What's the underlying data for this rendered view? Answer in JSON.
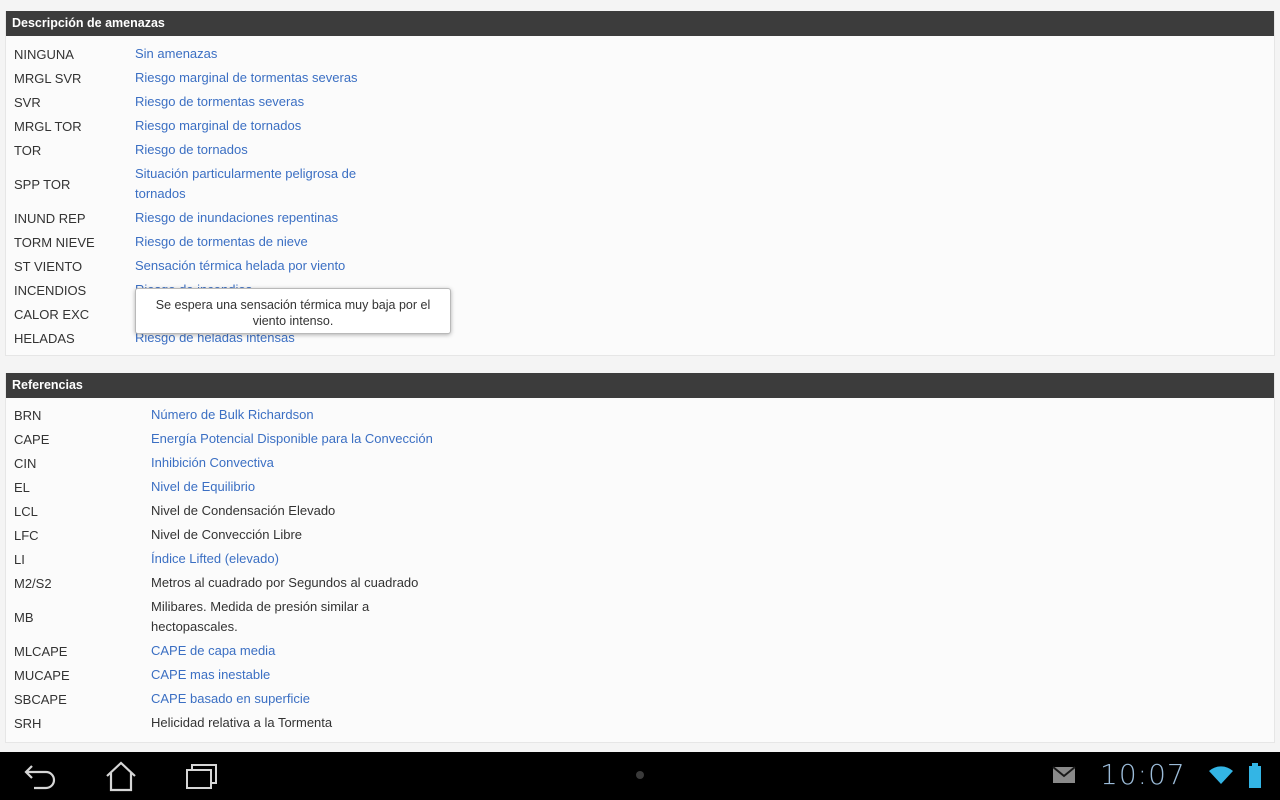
{
  "threats": {
    "title": "Descripción de amenazas",
    "items": [
      {
        "code": "NINGUNA",
        "desc": "Sin amenazas",
        "link": true
      },
      {
        "code": "MRGL SVR",
        "desc": "Riesgo marginal de tormentas severas",
        "link": true
      },
      {
        "code": "SVR",
        "desc": "Riesgo de tormentas severas",
        "link": true
      },
      {
        "code": "MRGL TOR",
        "desc": "Riesgo marginal de tornados",
        "link": true
      },
      {
        "code": "TOR",
        "desc": "Riesgo de tornados",
        "link": true
      },
      {
        "code": "SPP TOR",
        "desc": "Situación particularmente peligrosa de tornados",
        "link": true
      },
      {
        "code": "INUND REP",
        "desc": "Riesgo de inundaciones repentinas",
        "link": true
      },
      {
        "code": "TORM NIEVE",
        "desc": "Riesgo de tormentas de nieve",
        "link": true
      },
      {
        "code": "ST VIENTO",
        "desc": "Sensación térmica helada por viento",
        "link": true
      },
      {
        "code": "INCENDIOS",
        "desc": "Riesgo de incendios",
        "link": true
      },
      {
        "code": "CALOR EXC",
        "desc": "",
        "link": true
      },
      {
        "code": "HELADAS",
        "desc": "Riesgo de heladas intensas",
        "link": true
      }
    ]
  },
  "tooltip": {
    "text": "Se espera una sensación térmica muy baja por el viento intenso."
  },
  "references": {
    "title": "Referencias",
    "items": [
      {
        "code": "BRN",
        "desc": "Número de Bulk Richardson",
        "link": true
      },
      {
        "code": "CAPE",
        "desc": "Energía Potencial Disponible para la Convección",
        "link": true
      },
      {
        "code": "CIN",
        "desc": "Inhibición Convectiva",
        "link": true
      },
      {
        "code": "EL",
        "desc": "Nivel de Equilibrio",
        "link": true
      },
      {
        "code": "LCL",
        "desc": "Nivel de Condensación Elevado",
        "link": false
      },
      {
        "code": "LFC",
        "desc": "Nivel de Convección Libre",
        "link": false
      },
      {
        "code": "LI",
        "desc": "Índice Lifted (elevado)",
        "link": true
      },
      {
        "code": "M2/S2",
        "desc": "Metros al cuadrado por Segundos al cuadrado",
        "link": false
      },
      {
        "code": "MB",
        "desc": "Milibares. Medida de presión similar a hectopascales.",
        "link": false
      },
      {
        "code": "MLCAPE",
        "desc": "CAPE de capa media",
        "link": true
      },
      {
        "code": "MUCAPE",
        "desc": "CAPE mas inestable",
        "link": true
      },
      {
        "code": "SBCAPE",
        "desc": "CAPE basado en superficie",
        "link": true
      },
      {
        "code": "SRH",
        "desc": "Helicidad relativa a la Tormenta",
        "link": false
      }
    ]
  },
  "statusbar": {
    "time": "10:07",
    "icons": [
      "back-icon",
      "home-icon",
      "recent-apps-icon",
      "gmail-icon",
      "wifi-icon",
      "battery-icon"
    ],
    "accent_color": "#33b5e5"
  },
  "colors": {
    "link": "#3b6fc3",
    "header_bg": "#3c3c3c"
  }
}
